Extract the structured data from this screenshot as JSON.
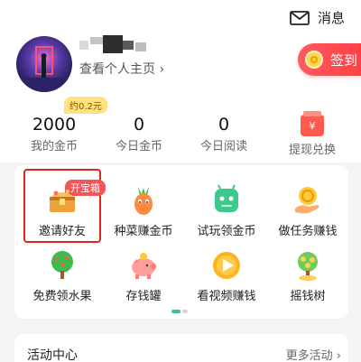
{
  "header": {
    "message_label": "消息",
    "message_icon": "envelope-icon"
  },
  "profile": {
    "view_profile_label": "查看个人主页 ›",
    "checkin_label": "签到",
    "checkin_icon": "coin-icon"
  },
  "stats": {
    "badge": "约0.2元",
    "items": [
      {
        "value": "2000",
        "label": "我的金币"
      },
      {
        "value": "0",
        "label": "今日金币"
      },
      {
        "value": "0",
        "label": "今日阅读"
      }
    ],
    "withdraw_label": "提现兑换",
    "withdraw_icon_glyph": "¥"
  },
  "grid": {
    "treasure_badge": "开宝箱",
    "items": [
      {
        "label": "邀请好友",
        "icon": "treasure-chest-icon"
      },
      {
        "label": "种菜赚金币",
        "icon": "carrot-icon"
      },
      {
        "label": "试玩领金币",
        "icon": "android-robot-icon"
      },
      {
        "label": "做任务赚钱",
        "icon": "task-coin-hand-icon"
      },
      {
        "label": "免费领水果",
        "icon": "fruit-tree-icon"
      },
      {
        "label": "存钱罐",
        "icon": "piggy-bank-icon"
      },
      {
        "label": "看视频赚钱",
        "icon": "play-button-icon"
      },
      {
        "label": "摇钱树",
        "icon": "money-tree-icon"
      }
    ],
    "page_count": 2,
    "active_page": 1
  },
  "activity": {
    "title": "活动中心",
    "more_label": "更多活动 ›"
  },
  "colors": {
    "accent_red": "#ff3d43",
    "highlight_red": "#e0251f",
    "badge_yellow": "#ffe27a",
    "active_dot_green": "#3ec48a"
  }
}
